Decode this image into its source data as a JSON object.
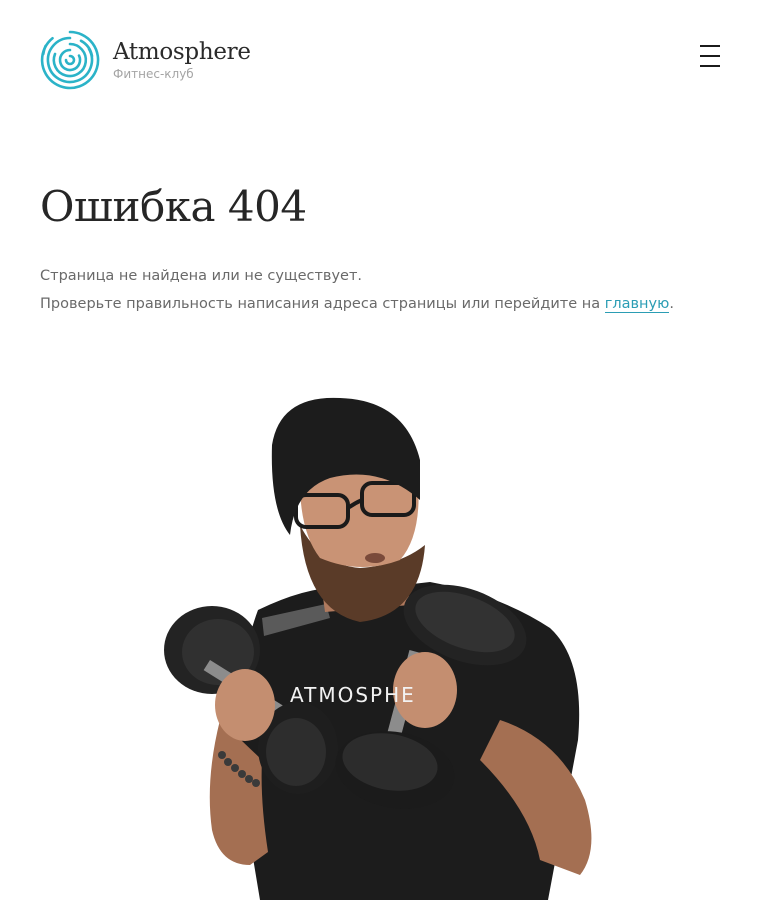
{
  "header": {
    "logo_name": "Atmosphere",
    "logo_subtitle": "Фитнес-клуб",
    "logo_icon": "concentric-circles-logo-icon",
    "menu_icon": "hamburger-menu-icon"
  },
  "main": {
    "title": "Ошибка 404",
    "line1": "Страница не найдена или не существует.",
    "line2_before_link": "Проверьте правильность написания адреса страницы или перейдите на ",
    "link_text": "главную",
    "line2_after_link": "."
  },
  "illustration": {
    "shirt_text": "ATMOSPHE"
  },
  "colors": {
    "accent": "#2b9db4",
    "logo_teal": "#2bb3c8",
    "text_dark": "#262626",
    "text_muted": "#6a6a6a"
  }
}
